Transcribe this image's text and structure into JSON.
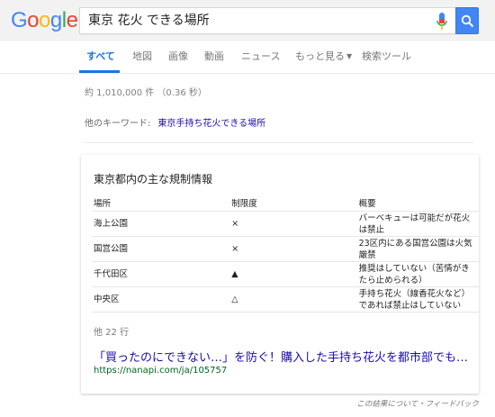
{
  "logo": {
    "letters": [
      "G",
      "o",
      "o",
      "g",
      "l",
      "e"
    ],
    "colors": [
      "#4285f4",
      "#ea4335",
      "#fbbc05",
      "#4285f4",
      "#34a853",
      "#ea4335"
    ]
  },
  "search": {
    "value": "東京 花火 できる場所",
    "button_icon": "search-icon",
    "mic_icon": "microphone-icon"
  },
  "tabs": [
    {
      "label": "すべて",
      "active": true
    },
    {
      "label": "地図"
    },
    {
      "label": "画像"
    },
    {
      "label": "動画"
    },
    {
      "label": "ニュース"
    },
    {
      "label": "もっと見る",
      "has_caret": true
    },
    {
      "label": "検索ツール"
    }
  ],
  "stats": "約 1,010,000 件 （0.36 秒）",
  "related": {
    "label": "他のキーワード:",
    "link": "東京手持ち花火できる場所"
  },
  "card": {
    "title": "東京都内の主な規制情報",
    "headers": [
      "場所",
      "制限度",
      "概要"
    ],
    "rows": [
      {
        "place": "海上公園",
        "level": "×",
        "summary": "バーベキューは可能だが花火は禁止"
      },
      {
        "place": "国営公園",
        "level": "×",
        "summary": "23区内にある国営公園は火気厳禁"
      },
      {
        "place": "千代田区",
        "level": "▲",
        "summary": "推奨はしていない（苦情がきたら止められる）"
      },
      {
        "place": "中央区",
        "level": "△",
        "summary": "手持ち花火（線香花火など）であれば禁止はしていない"
      }
    ],
    "more_rows": "他 22 行",
    "result_title": "「買ったのにできない…」を防ぐ！購入した手持ち花火を都市部でも通…",
    "result_url": "https://nanapi.com/ja/105757"
  },
  "feedback": "この結果について・フィードバック",
  "colors": {
    "accent": "#1a73e8",
    "link": "#1a0dab",
    "url_green": "#006621",
    "search_button": "#4285f4"
  }
}
